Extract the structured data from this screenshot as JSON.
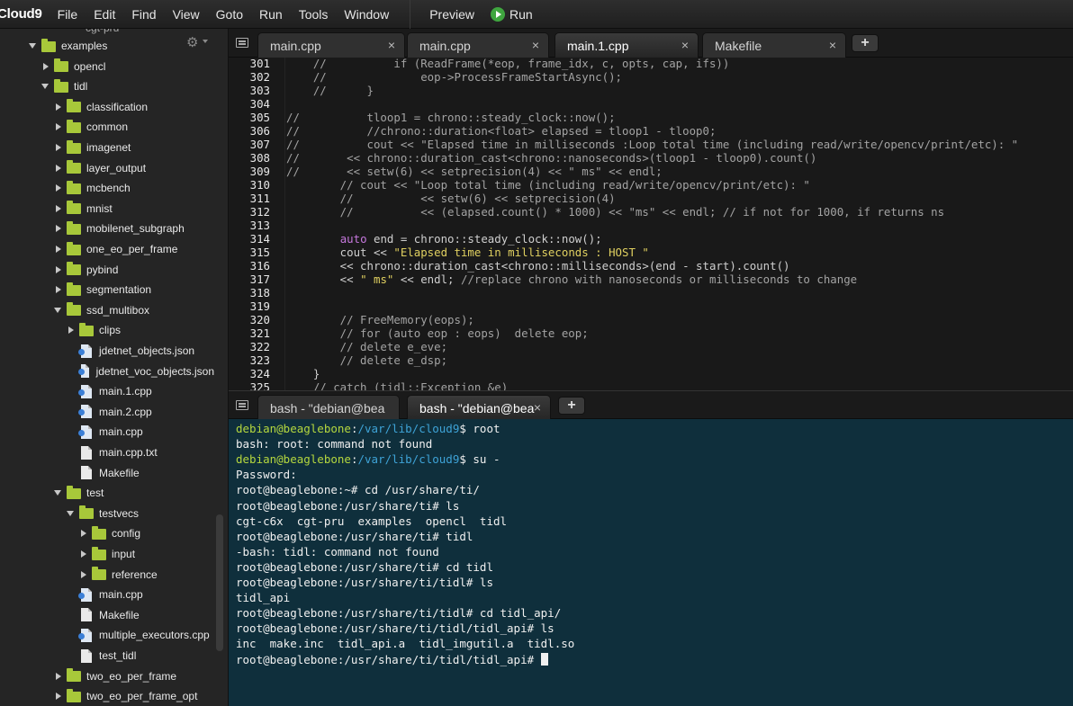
{
  "menubar": {
    "brand": "Cloud9",
    "items": [
      "File",
      "Edit",
      "Find",
      "View",
      "Goto",
      "Run",
      "Tools",
      "Window"
    ],
    "preview_label": "Preview",
    "run_label": "Run"
  },
  "sidebar": {
    "cut_label": "cgt-pru",
    "tree": [
      {
        "label": "examples",
        "kind": "folder",
        "open": true,
        "depth": 0
      },
      {
        "label": "opencl",
        "kind": "folder",
        "open": false,
        "depth": 1
      },
      {
        "label": "tidl",
        "kind": "folder",
        "open": true,
        "depth": 1
      },
      {
        "label": "classification",
        "kind": "folder",
        "open": false,
        "depth": 2
      },
      {
        "label": "common",
        "kind": "folder",
        "open": false,
        "depth": 2
      },
      {
        "label": "imagenet",
        "kind": "folder",
        "open": false,
        "depth": 2
      },
      {
        "label": "layer_output",
        "kind": "folder",
        "open": false,
        "depth": 2
      },
      {
        "label": "mcbench",
        "kind": "folder",
        "open": false,
        "depth": 2
      },
      {
        "label": "mnist",
        "kind": "folder",
        "open": false,
        "depth": 2
      },
      {
        "label": "mobilenet_subgraph",
        "kind": "folder",
        "open": false,
        "depth": 2
      },
      {
        "label": "one_eo_per_frame",
        "kind": "folder",
        "open": false,
        "depth": 2
      },
      {
        "label": "pybind",
        "kind": "folder",
        "open": false,
        "depth": 2
      },
      {
        "label": "segmentation",
        "kind": "folder",
        "open": false,
        "depth": 2
      },
      {
        "label": "ssd_multibox",
        "kind": "folder",
        "open": true,
        "depth": 2
      },
      {
        "label": "clips",
        "kind": "folder",
        "open": false,
        "depth": 3
      },
      {
        "label": "jdetnet_objects.json",
        "kind": "json",
        "depth": 3
      },
      {
        "label": "jdetnet_voc_objects.json",
        "kind": "json",
        "depth": 3
      },
      {
        "label": "main.1.cpp",
        "kind": "cpp",
        "depth": 3
      },
      {
        "label": "main.2.cpp",
        "kind": "cpp",
        "depth": 3
      },
      {
        "label": "main.cpp",
        "kind": "cpp",
        "depth": 3
      },
      {
        "label": "main.cpp.txt",
        "kind": "file",
        "depth": 3
      },
      {
        "label": "Makefile",
        "kind": "file",
        "depth": 3
      },
      {
        "label": "test",
        "kind": "folder",
        "open": true,
        "depth": 2
      },
      {
        "label": "testvecs",
        "kind": "folder",
        "open": true,
        "depth": 3
      },
      {
        "label": "config",
        "kind": "folder",
        "open": false,
        "depth": 4
      },
      {
        "label": "input",
        "kind": "folder",
        "open": false,
        "depth": 4
      },
      {
        "label": "reference",
        "kind": "folder",
        "open": false,
        "depth": 4
      },
      {
        "label": "main.cpp",
        "kind": "cpp",
        "depth": 3
      },
      {
        "label": "Makefile",
        "kind": "file",
        "depth": 3
      },
      {
        "label": "multiple_executors.cpp",
        "kind": "cpp",
        "depth": 3
      },
      {
        "label": "test_tidl",
        "kind": "file",
        "depth": 3
      },
      {
        "label": "two_eo_per_frame",
        "kind": "folder",
        "open": false,
        "depth": 2
      },
      {
        "label": "two_eo_per_frame_opt",
        "kind": "folder",
        "open": false,
        "depth": 2
      }
    ]
  },
  "editor": {
    "tabs": [
      {
        "label": "main.cpp",
        "active": false,
        "close": "×"
      },
      {
        "label": "main.cpp",
        "active": false,
        "close": "×"
      },
      {
        "label": "main.1.cpp",
        "active": true,
        "close": "×"
      },
      {
        "label": "Makefile",
        "active": false,
        "close": "×"
      }
    ],
    "add_tab_label": "+",
    "lines": [
      {
        "n": "301",
        "parts": [
          [
            "c-comment",
            "    //          if (ReadFrame(*eop, frame_idx, c, opts, cap, ifs))"
          ]
        ]
      },
      {
        "n": "302",
        "parts": [
          [
            "c-comment",
            "    //              eop->ProcessFrameStartAsync();"
          ]
        ]
      },
      {
        "n": "303",
        "parts": [
          [
            "c-comment",
            "    //      }"
          ]
        ]
      },
      {
        "n": "304",
        "parts": [
          [
            "",
            ""
          ]
        ]
      },
      {
        "n": "305",
        "parts": [
          [
            "c-comment",
            "//          tloop1 = chrono::steady_clock::now();"
          ]
        ]
      },
      {
        "n": "306",
        "parts": [
          [
            "c-comment",
            "//          //chrono::duration<float> elapsed = tloop1 - tloop0;"
          ]
        ]
      },
      {
        "n": "307",
        "parts": [
          [
            "c-comment",
            "//          cout << \"Elapsed time in milliseconds :Loop total time (including read/write/opencv/print/etc): \""
          ]
        ]
      },
      {
        "n": "308",
        "parts": [
          [
            "c-comment",
            "//       << chrono::duration_cast<chrono::nanoseconds>(tloop1 - tloop0).count()"
          ]
        ]
      },
      {
        "n": "309",
        "parts": [
          [
            "c-comment",
            "//       << setw(6) << setprecision(4) << \" ms\" << endl;"
          ]
        ]
      },
      {
        "n": "310",
        "parts": [
          [
            "c-comment",
            "        // cout << \"Loop total time (including read/write/opencv/print/etc): \""
          ]
        ]
      },
      {
        "n": "311",
        "parts": [
          [
            "c-comment",
            "        //          << setw(6) << setprecision(4)"
          ]
        ]
      },
      {
        "n": "312",
        "parts": [
          [
            "c-comment",
            "        //          << (elapsed.count() * 1000) << \"ms\" << endl; // if not for 1000, if returns ns"
          ]
        ]
      },
      {
        "n": "313",
        "parts": [
          [
            "",
            ""
          ]
        ]
      },
      {
        "n": "314",
        "parts": [
          [
            "",
            "        "
          ],
          [
            "c-kw",
            "auto"
          ],
          [
            "",
            " end = chrono::steady_clock::now();"
          ]
        ]
      },
      {
        "n": "315",
        "parts": [
          [
            "",
            "        cout << "
          ],
          [
            "c-str",
            "\"Elapsed time in milliseconds : HOST \""
          ]
        ]
      },
      {
        "n": "316",
        "parts": [
          [
            "",
            "        << chrono::duration_cast<chrono::milliseconds>(end - start).count()"
          ]
        ]
      },
      {
        "n": "317",
        "parts": [
          [
            "",
            "        << "
          ],
          [
            "c-str",
            "\" ms\""
          ],
          [
            "",
            " << endl; "
          ],
          [
            "c-comment",
            "//replace chrono with nanoseconds or milliseconds to change"
          ]
        ]
      },
      {
        "n": "318",
        "parts": [
          [
            "",
            ""
          ]
        ]
      },
      {
        "n": "319",
        "parts": [
          [
            "",
            ""
          ]
        ]
      },
      {
        "n": "320",
        "parts": [
          [
            "c-comment",
            "        // FreeMemory(eops);"
          ]
        ]
      },
      {
        "n": "321",
        "parts": [
          [
            "c-comment",
            "        // for (auto eop : eops)  delete eop;"
          ]
        ]
      },
      {
        "n": "322",
        "parts": [
          [
            "c-comment",
            "        // delete e_eve;"
          ]
        ]
      },
      {
        "n": "323",
        "parts": [
          [
            "c-comment",
            "        // delete e_dsp;"
          ]
        ]
      },
      {
        "n": "324",
        "parts": [
          [
            "",
            "    }"
          ]
        ]
      },
      {
        "n": "325",
        "parts": [
          [
            "c-comment",
            "    // catch (tidl::Exception &e)"
          ]
        ]
      }
    ]
  },
  "terminal": {
    "tabs": [
      {
        "label": "bash - \"debian@bea",
        "active": false
      },
      {
        "label": "bash - \"debian@bea",
        "active": true,
        "close": "×"
      }
    ],
    "add_tab_label": "+",
    "lines": [
      {
        "user": "debian@beaglebone",
        "path": "/var/lib/cloud9",
        "rest": "$ root"
      },
      {
        "text": "bash: root: command not found"
      },
      {
        "user": "debian@beaglebone",
        "path": "/var/lib/cloud9",
        "rest": "$ su -"
      },
      {
        "text": "Password:"
      },
      {
        "text": "root@beaglebone:~# cd /usr/share/ti/"
      },
      {
        "text": "root@beaglebone:/usr/share/ti# ls"
      },
      {
        "text": "cgt-c6x  cgt-pru  examples  opencl  tidl"
      },
      {
        "text": "root@beaglebone:/usr/share/ti# tidl"
      },
      {
        "text": "-bash: tidl: command not found"
      },
      {
        "text": "root@beaglebone:/usr/share/ti# cd tidl"
      },
      {
        "text": "root@beaglebone:/usr/share/ti/tidl# ls"
      },
      {
        "text": "tidl_api"
      },
      {
        "text": "root@beaglebone:/usr/share/ti/tidl# cd tidl_api/"
      },
      {
        "text": "root@beaglebone:/usr/share/ti/tidl/tidl_api# ls"
      },
      {
        "text": "inc  make.inc  tidl_api.a  tidl_imgutil.a  tidl.so"
      },
      {
        "text": "root@beaglebone:/usr/share/ti/tidl/tidl_api# ",
        "cursor": true
      }
    ]
  }
}
